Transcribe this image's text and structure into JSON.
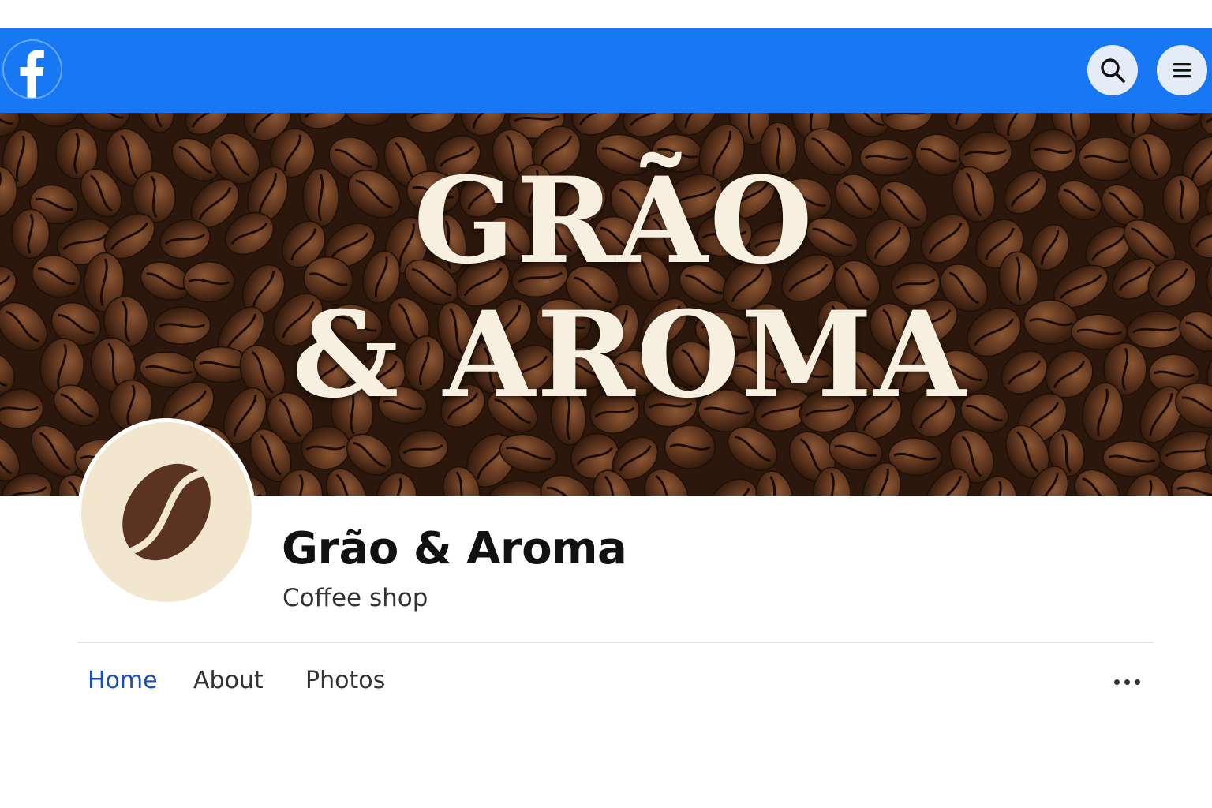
{
  "header": {
    "logo_icon": "facebook-logo-icon",
    "search_icon": "search-icon",
    "menu_icon": "hamburger-menu-icon",
    "brand_color": "#1877f2"
  },
  "cover": {
    "title_line1": "GRÃO",
    "title_line2": "& AROMA",
    "image": "coffee-beans"
  },
  "profile": {
    "avatar_icon": "coffee-bean-icon",
    "name": "Grão & Aroma",
    "category": "Coffee shop"
  },
  "tabs": {
    "items": [
      {
        "label": "Home",
        "active": true
      },
      {
        "label": "About",
        "active": false
      },
      {
        "label": "Photos",
        "active": false
      }
    ],
    "more_icon": "more-dots-icon",
    "active_color": "#1a4fc4"
  }
}
